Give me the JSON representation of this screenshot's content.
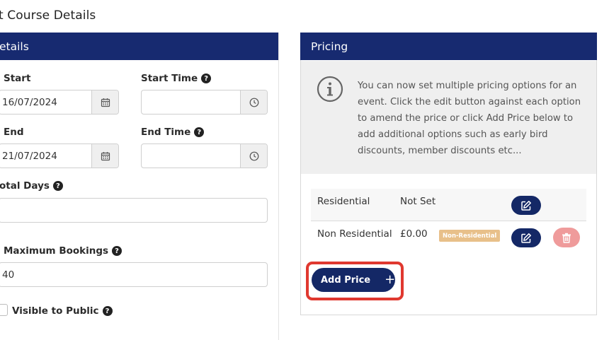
{
  "page": {
    "title": "t Course Details"
  },
  "details_panel": {
    "header": "etails",
    "start_label": "Start",
    "start_value": "16/07/2024",
    "start_time_label": "Start Time",
    "start_time_value": "",
    "end_label": "End",
    "end_value": "21/07/2024",
    "end_time_label": "End Time",
    "end_time_value": "",
    "total_days_label": "otal Days",
    "total_days_value": "",
    "max_bookings_label": "Maximum Bookings",
    "max_bookings_value": "40",
    "visible_label": "Visible to Public",
    "help_glyph": "?"
  },
  "pricing_panel": {
    "header": "Pricing",
    "info_text": "You can now set multiple pricing options for an event. Click the edit button against each option to amend the price or click Add Price below to add additional options such as early bird discounts, member discounts etc...",
    "rows": [
      {
        "name": "Residential",
        "price": "Not Set",
        "badge": ""
      },
      {
        "name": "Non Residential",
        "price": "£0.00",
        "badge": "Non-Residential"
      }
    ],
    "add_price_label": "Add Price",
    "add_price_icon": "+"
  },
  "colors": {
    "header_bg": "#172a70",
    "button_bg": "#142866",
    "badge_bg": "#e8c08a",
    "delete_bg": "#ef9b9b",
    "highlight": "#e0382f"
  }
}
